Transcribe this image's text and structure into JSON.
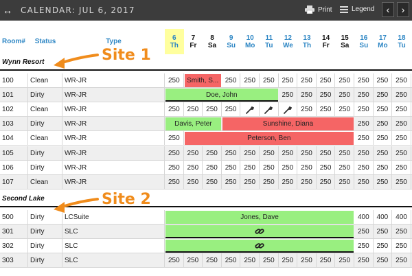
{
  "topbar": {
    "back_icon": "↔",
    "title": "CALENDAR: JUL 6, 2017",
    "print_label": "Print",
    "legend_label": "Legend",
    "prev_icon": "‹",
    "next_icon": "›"
  },
  "columns": {
    "room": "Room#",
    "status": "Status",
    "type": "Type"
  },
  "days": [
    {
      "num": "6",
      "dow": "Th",
      "style": "today"
    },
    {
      "num": "7",
      "dow": "Fr",
      "style": "dark"
    },
    {
      "num": "8",
      "dow": "Sa",
      "style": "dark"
    },
    {
      "num": "9",
      "dow": "Su",
      "style": "blue"
    },
    {
      "num": "10",
      "dow": "Mo",
      "style": "blue"
    },
    {
      "num": "11",
      "dow": "Tu",
      "style": "blue"
    },
    {
      "num": "12",
      "dow": "We",
      "style": "blue"
    },
    {
      "num": "13",
      "dow": "Th",
      "style": "blue"
    },
    {
      "num": "14",
      "dow": "Fr",
      "style": "dark"
    },
    {
      "num": "15",
      "dow": "Sa",
      "style": "dark"
    },
    {
      "num": "16",
      "dow": "Su",
      "style": "blue"
    },
    {
      "num": "17",
      "dow": "Mo",
      "style": "blue"
    },
    {
      "num": "18",
      "dow": "Tu",
      "style": "blue"
    }
  ],
  "colors": {
    "available": "#99ef80",
    "occupied": "#f56565",
    "today": "#ffff9e",
    "annotation": "#f08c1c"
  },
  "annotations": {
    "site1": "Site 1",
    "site2": "Site 2"
  },
  "sites": [
    {
      "name": "Wynn Resort",
      "rooms": [
        {
          "room": "100",
          "status": "Clean",
          "type": "WR-JR",
          "cells": [
            "250",
            null,
            null,
            "250",
            "250",
            "250",
            "250",
            "250",
            "250",
            "250",
            "250",
            "250",
            "250"
          ],
          "bookings": [
            {
              "label": "Smith, S...",
              "start": 1,
              "span": 2,
              "color": "red"
            }
          ]
        },
        {
          "room": "101",
          "status": "Dirty",
          "type": "WR-JR",
          "cells": [
            null,
            null,
            null,
            null,
            null,
            null,
            "250",
            "250",
            "250",
            "250",
            "250",
            "250",
            "250"
          ],
          "bookings": [
            {
              "label": "Doe, John",
              "start": 0,
              "span": 6,
              "color": "green",
              "underline": true
            }
          ]
        },
        {
          "room": "102",
          "status": "Clean",
          "type": "WR-JR",
          "cells": [
            "250",
            "250",
            "250",
            "250",
            "wrench",
            "wrench",
            "wrench",
            "250",
            "250",
            "250",
            "250",
            "250",
            "250"
          ],
          "bookings": []
        },
        {
          "room": "103",
          "status": "Dirty",
          "type": "WR-JR",
          "cells": [
            null,
            null,
            null,
            null,
            null,
            null,
            null,
            null,
            null,
            null,
            "250",
            "250",
            "250"
          ],
          "bookings": [
            {
              "label": "Davis, Peter",
              "start": 0,
              "span": 3,
              "color": "green"
            },
            {
              "label": "Sunshine, Diana",
              "start": 3,
              "span": 7,
              "color": "red"
            }
          ]
        },
        {
          "room": "104",
          "status": "Clean",
          "type": "WR-JR",
          "cells": [
            "250",
            null,
            null,
            null,
            null,
            null,
            null,
            null,
            null,
            null,
            "250",
            "250",
            "250"
          ],
          "bookings": [
            {
              "label": "Peterson, Ben",
              "start": 1,
              "span": 9,
              "color": "red"
            }
          ]
        },
        {
          "room": "105",
          "status": "Dirty",
          "type": "WR-JR",
          "cells": [
            "250",
            "250",
            "250",
            "250",
            "250",
            "250",
            "250",
            "250",
            "250",
            "250",
            "250",
            "250",
            "250"
          ],
          "bookings": []
        },
        {
          "room": "106",
          "status": "Dirty",
          "type": "WR-JR",
          "cells": [
            "250",
            "250",
            "250",
            "250",
            "250",
            "250",
            "250",
            "250",
            "250",
            "250",
            "250",
            "250",
            "250"
          ],
          "bookings": []
        },
        {
          "room": "107",
          "status": "Clean",
          "type": "WR-JR",
          "cells": [
            "250",
            "250",
            "250",
            "250",
            "250",
            "250",
            "250",
            "250",
            "250",
            "250",
            "250",
            "250",
            "250"
          ],
          "bookings": []
        }
      ]
    },
    {
      "name": "Second Lake",
      "rooms": [
        {
          "room": "500",
          "status": "Dirty",
          "type": "LCSuite",
          "cells": [
            null,
            null,
            null,
            null,
            null,
            null,
            null,
            null,
            null,
            null,
            "400",
            "400",
            "400"
          ],
          "bookings": [
            {
              "label": "Jones, Dave",
              "start": 0,
              "span": 10,
              "color": "green"
            }
          ]
        },
        {
          "room": "301",
          "status": "Dirty",
          "type": "SLC",
          "cells": [
            null,
            null,
            null,
            null,
            null,
            null,
            null,
            null,
            null,
            null,
            "250",
            "250",
            "250"
          ],
          "bookings": [
            {
              "label": "",
              "icon": "link",
              "start": 0,
              "span": 10,
              "color": "green",
              "underline": true
            }
          ]
        },
        {
          "room": "302",
          "status": "Dirty",
          "type": "SLC",
          "cells": [
            null,
            null,
            null,
            null,
            null,
            null,
            null,
            null,
            null,
            null,
            "250",
            "250",
            "250"
          ],
          "bookings": [
            {
              "label": "",
              "icon": "link",
              "start": 0,
              "span": 10,
              "color": "green",
              "underline": true
            }
          ]
        },
        {
          "room": "303",
          "status": "Dirty",
          "type": "SLC",
          "cells": [
            "250",
            "250",
            "250",
            "250",
            "250",
            "250",
            "250",
            "250",
            "250",
            "250",
            "250",
            "250",
            "250"
          ],
          "bookings": []
        }
      ]
    }
  ]
}
